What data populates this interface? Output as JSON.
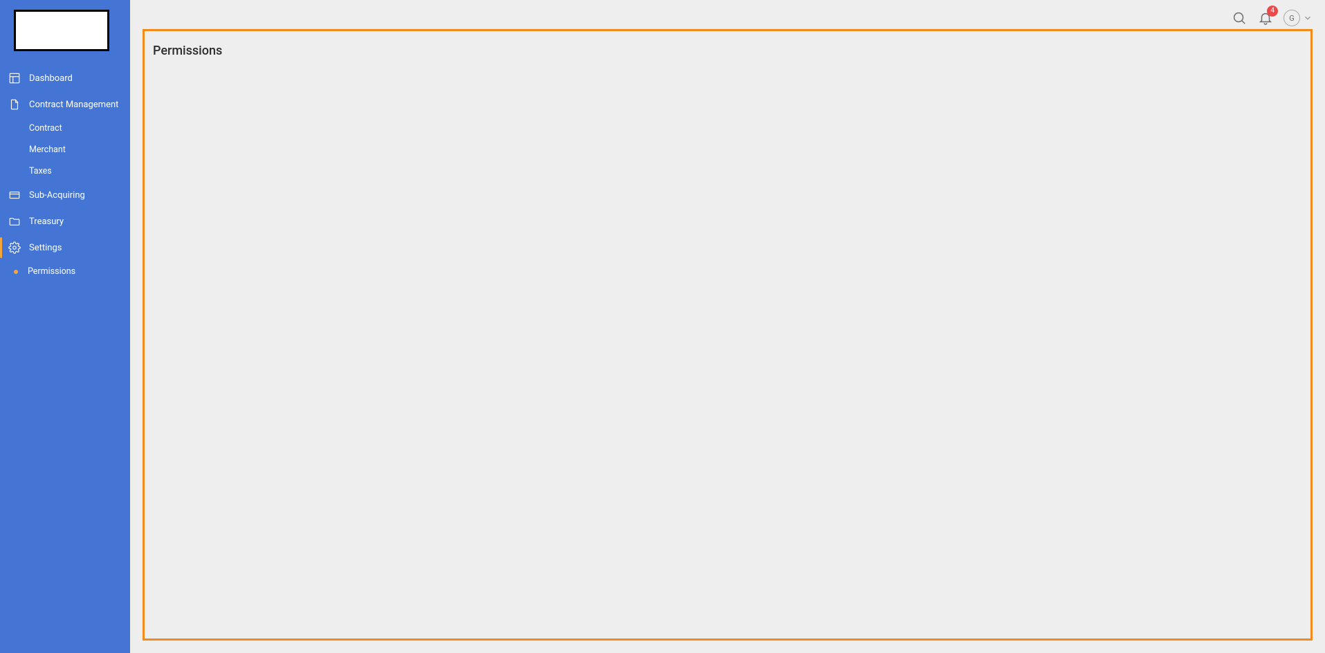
{
  "colors": {
    "sidebar_bg": "#4475d5",
    "accent": "#f28a1c",
    "badge": "#ec4a4a"
  },
  "header": {
    "notification_count": "4",
    "avatar_initial": "G"
  },
  "sidebar": {
    "items": {
      "dashboard": {
        "label": "Dashboard"
      },
      "contract_management": {
        "label": "Contract Management",
        "children": {
          "contract": {
            "label": "Contract"
          },
          "merchant": {
            "label": "Merchant"
          },
          "taxes": {
            "label": "Taxes"
          }
        }
      },
      "sub_acquiring": {
        "label": "Sub-Acquiring"
      },
      "treasury": {
        "label": "Treasury"
      },
      "settings": {
        "label": "Settings",
        "children": {
          "permissions": {
            "label": "Permissions"
          }
        }
      }
    }
  },
  "page": {
    "title": "Permissions"
  }
}
